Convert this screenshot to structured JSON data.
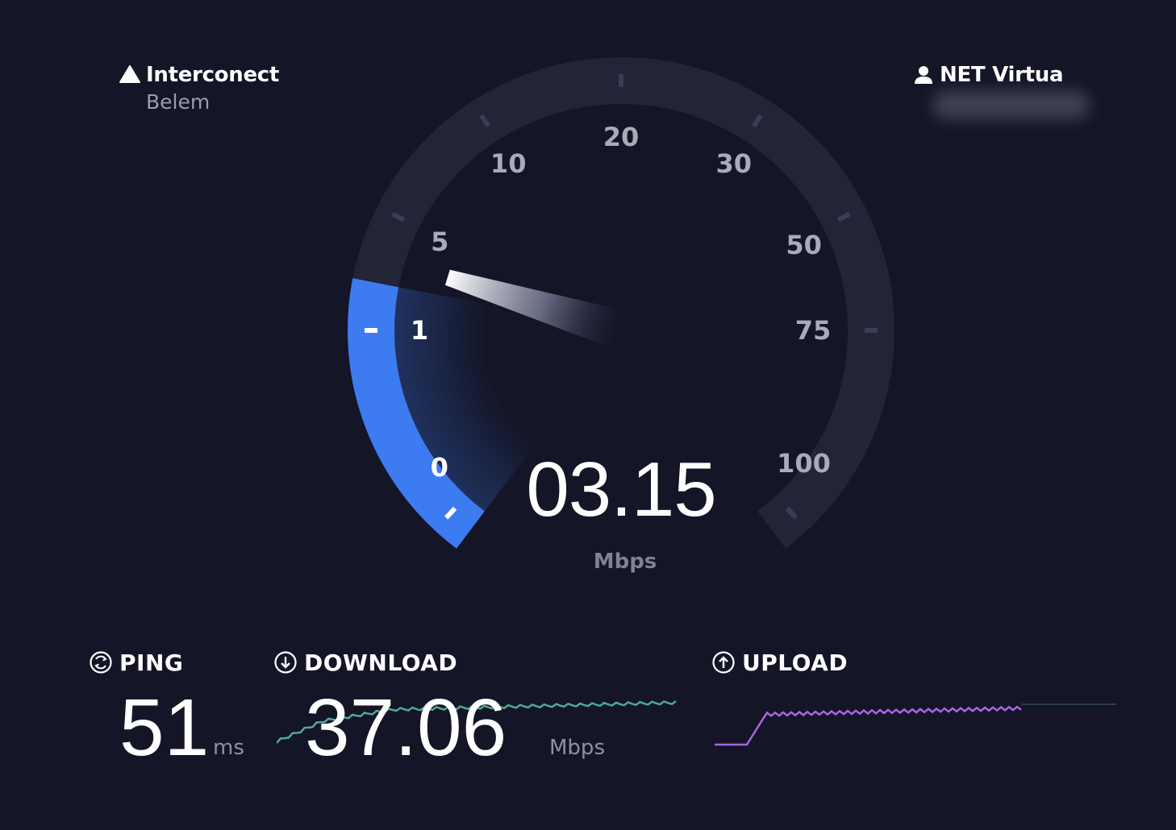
{
  "server": {
    "name": "Interconect",
    "location": "Belem"
  },
  "isp": {
    "name": "NET Virtua"
  },
  "gauge": {
    "scale_labels": [
      "0",
      "1",
      "5",
      "10",
      "20",
      "30",
      "50",
      "75",
      "100"
    ],
    "current_value": "03.15",
    "unit": "Mbps",
    "colors": {
      "track": "#222438",
      "fill": "#3d7bf0",
      "needle": "#ffffff"
    }
  },
  "metrics": {
    "ping": {
      "title": "PING",
      "value": "51",
      "unit": "ms",
      "icon": "ping-icon"
    },
    "download": {
      "title": "DOWNLOAD",
      "value": "37.06",
      "unit": "Mbps",
      "icon": "download-arrow-icon",
      "graph_color": "#4fa89a"
    },
    "upload": {
      "title": "UPLOAD",
      "icon": "upload-arrow-icon",
      "graph_color": "#a865e8"
    }
  }
}
